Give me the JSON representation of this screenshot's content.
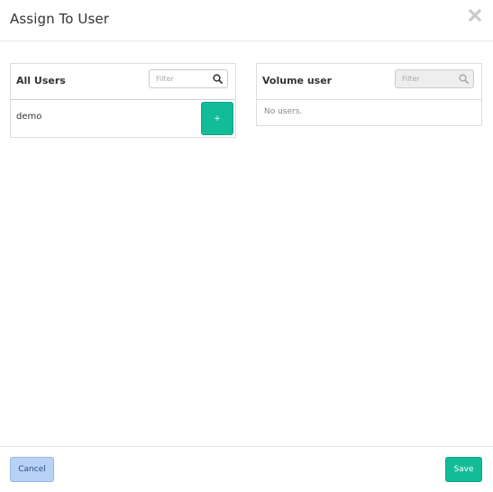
{
  "modal": {
    "title": "Assign To User",
    "close_icon": "close-icon"
  },
  "all_users": {
    "title": "All Users",
    "filter_placeholder": "Filter",
    "search_icon": "search-icon",
    "items": [
      {
        "name": "demo",
        "add_label": "+"
      }
    ]
  },
  "volume_user": {
    "title": "Volume user",
    "filter_placeholder": "Filter",
    "search_icon": "search-icon",
    "empty_text": "No users."
  },
  "footer": {
    "cancel_label": "Cancel",
    "save_label": "Save"
  },
  "colors": {
    "accent": "#12bc98",
    "cancel_bg": "#b8d2f5"
  }
}
